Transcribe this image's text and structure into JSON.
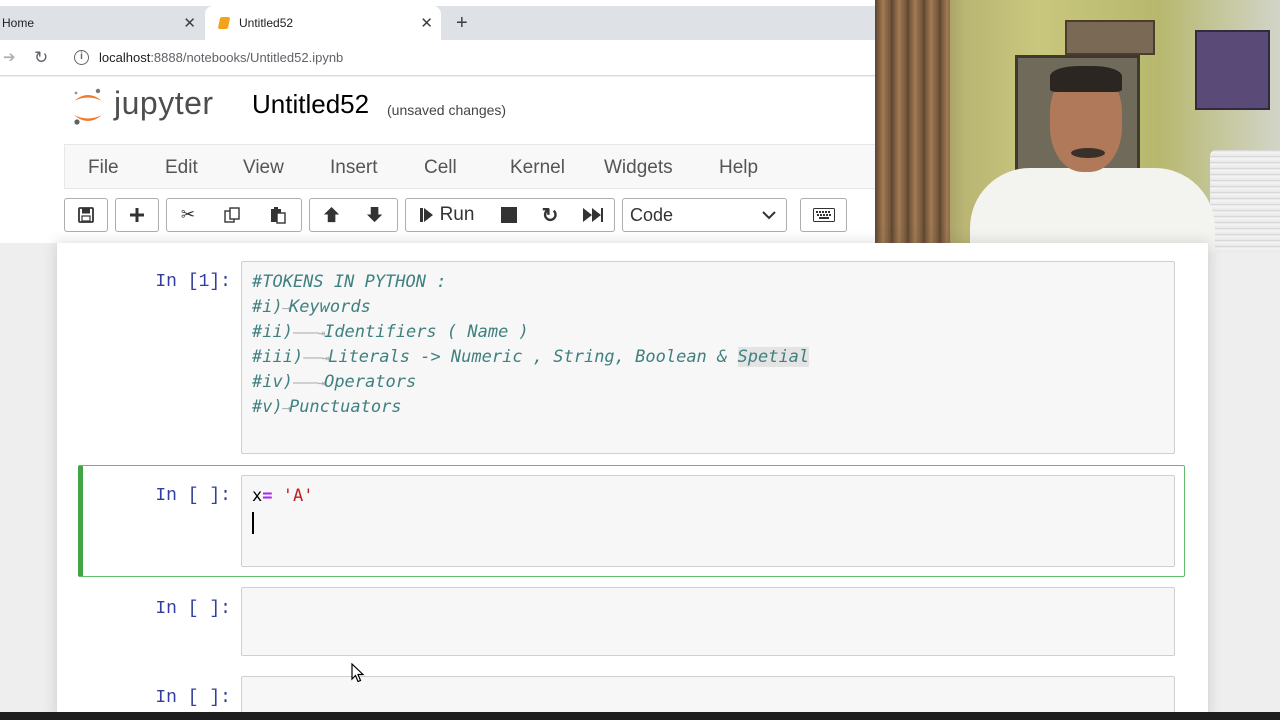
{
  "browser": {
    "tabs": [
      {
        "title": "Home",
        "active": false
      },
      {
        "title": "Untitled52",
        "active": true
      }
    ],
    "url_host": "localhost",
    "url_path": ":8888/notebooks/Untitled52.ipynb"
  },
  "jupyter": {
    "wordmark": "jupyter",
    "notebook_title": "Untitled52",
    "save_status": "(unsaved changes)",
    "menu": [
      "File",
      "Edit",
      "View",
      "Insert",
      "Cell",
      "Kernel",
      "Widgets",
      "Help"
    ],
    "toolbar": {
      "run_label": "Run",
      "cell_type": "Code",
      "icons": [
        "save-icon",
        "plus-icon",
        "scissors-icon",
        "copy-icon",
        "paste-icon",
        "arrow-up-icon",
        "arrow-down-icon",
        "step-forward-icon",
        "stop-icon",
        "restart-icon",
        "fast-forward-icon",
        "keyboard-icon"
      ]
    }
  },
  "cells": [
    {
      "prompt": "In [1]:",
      "lines": [
        {
          "prefix": "#TOKENS IN PYTHON :",
          "arrow": "",
          "rest": ""
        },
        {
          "prefix": "#i)",
          "arrow": "⟶",
          "rest": "Keywords"
        },
        {
          "prefix": "#ii)",
          "arrow": "────⇥",
          "rest": "Identifiers ( Name )"
        },
        {
          "prefix": "#iii)",
          "arrow": "───⇥",
          "rest": "Literals -> Numeric , String, Boolean & ",
          "highlight": "Spetial"
        },
        {
          "prefix": "#iv)",
          "arrow": "────⇥",
          "rest": "Operators"
        },
        {
          "prefix": "#v)",
          "arrow": "⟶",
          "rest": "Punctuators"
        }
      ]
    },
    {
      "prompt": "In [ ]:",
      "code": {
        "var": "x",
        "op": "=",
        "str": " 'A'"
      },
      "selected": true
    },
    {
      "prompt": "In [ ]:"
    },
    {
      "prompt": "In [ ]:"
    }
  ],
  "colors": {
    "prompt": "#303f9f",
    "comment": "#408080",
    "selected_border": "#42a545",
    "string": "#ba2121",
    "operator": "#aa22ff"
  }
}
